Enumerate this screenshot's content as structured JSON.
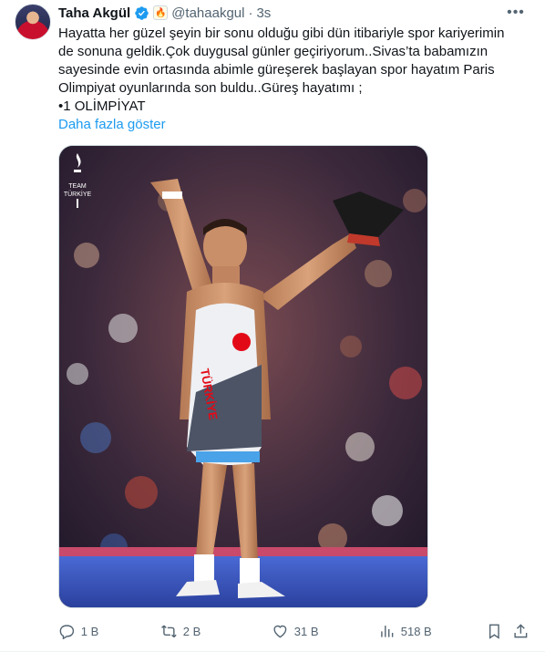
{
  "author": {
    "display_name": "Taha Akgül",
    "handle": "@tahaakgul",
    "separator": "·",
    "time": "3s",
    "affiliation_icon": "olympic-flame-badge-icon",
    "verified_color": "#1d9bf0"
  },
  "tweet": {
    "text": "Hayatta her güzel şeyin bir sonu olduğu gibi dün itibariyle spor kariyerimin de sonuna geldik.Çok duygusal günler geçiriyorum..Sivas’ta babamızın sayesinde evin ortasında abimle güreşerek başlayan spor hayatım Paris Olimpiyat oyunlarında son buldu..Güreş hayatımı ;\n•1 OLİMPİYAT",
    "show_more": "Daha fazla göster"
  },
  "media": {
    "logo_text_line1": "TEAM",
    "logo_text_line2": "TÜRKİYE",
    "singlet_text": "TÜRKİYE",
    "description_icon": "wrestler-celebration-photo"
  },
  "actions": {
    "reply_count": "1 B",
    "retweet_count": "2 B",
    "like_count": "31 B",
    "views_count": "518 B"
  },
  "colors": {
    "link": "#1d9bf0",
    "secondary_text": "#536471",
    "primary_text": "#0f1419"
  }
}
